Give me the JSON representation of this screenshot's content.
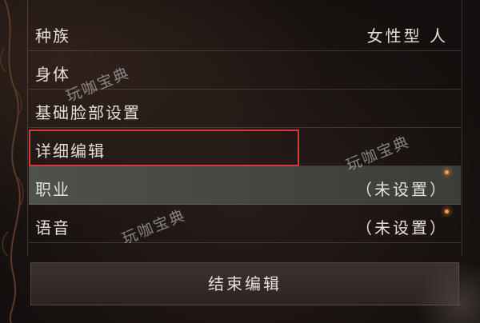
{
  "menu": {
    "items": [
      {
        "label": "种族",
        "value": "女性型 人"
      },
      {
        "label": "身体",
        "value": ""
      },
      {
        "label": "基础脸部设置",
        "value": ""
      },
      {
        "label": "详细编辑",
        "value": ""
      },
      {
        "label": "职业",
        "value": "（未设置）"
      },
      {
        "label": "语音",
        "value": "（未设置）"
      }
    ],
    "selected_index": 3,
    "hovered_index": 4
  },
  "end_button": {
    "label": "结束编辑"
  },
  "watermark": {
    "text": "玩咖宝典"
  },
  "colors": {
    "selection_box": "#d7383b",
    "hover_row": "#4e514c",
    "text": "#e8e0d6",
    "glow": "#f2a146"
  }
}
